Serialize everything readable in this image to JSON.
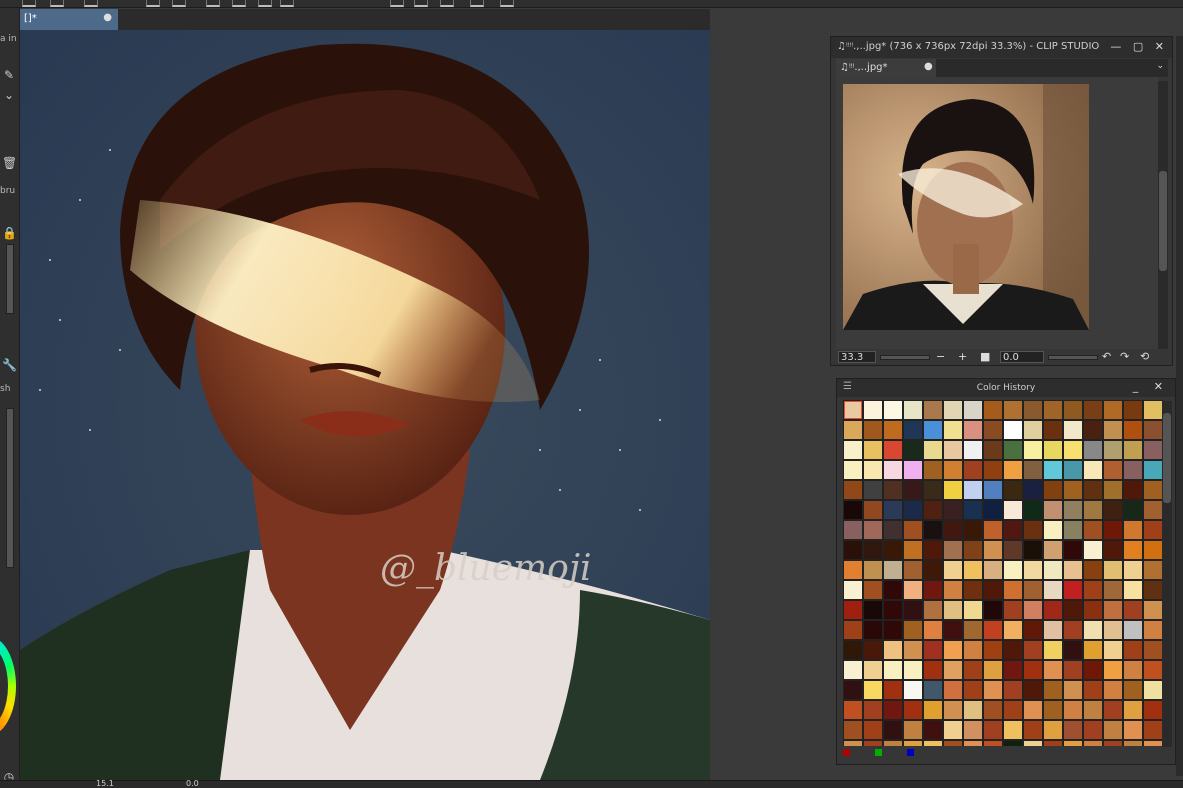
{
  "canvas_tab": {
    "label": "[]*",
    "modified_dot": "●"
  },
  "left_panel": {
    "cut_text_1": "a in",
    "cut_text_2": "bru",
    "cut_text_3": "sh"
  },
  "navigator": {
    "title": "♫ᵎᵎᵎᵎ.,..jpg* (736 x 736px 72dpi 33.3%)  - CLIP STUDIO",
    "window_buttons": "— ▢ ✕",
    "tab_label": "♫ᵎᵎᵎ.,..jpg*",
    "tab_dot": "●",
    "zoom_value": "33.3",
    "rotation_value": "0.0",
    "zoom_out": "−",
    "zoom_in": "+",
    "rotate_left": "↶",
    "rotate_right": "↷",
    "reset": "⟲"
  },
  "color_history": {
    "title": "Color History",
    "window_buttons": "_ ✕",
    "swatches": [
      "#e8c9a0",
      "#fbf3dc",
      "#fdf7e6",
      "#e8e4c8",
      "#a9794c",
      "#e2d5b4",
      "#d9d4c8",
      "#a55b1a",
      "#b07030",
      "#8a5a2e",
      "#a06428",
      "#8f5a20",
      "#7a3e14",
      "#b06a26",
      "#7a3a10",
      "#e0c060",
      "#d9a85a",
      "#a0581c",
      "#c06a20",
      "#1f3656",
      "#4a90d9",
      "#f0e090",
      "#d99080",
      "#8a4a22",
      "#fefefe",
      "#e0d0a0",
      "#6a3010",
      "#f2e7c8",
      "#4a2010",
      "#c09050",
      "#b05010",
      "#8a5030",
      "#f8f0c8",
      "#e8c060",
      "#d84830",
      "#1a2a1a",
      "#e8d890",
      "#e8c8a0",
      "#f0f0f0",
      "#6a3a1a",
      "#4a7040",
      "#f8f0a0",
      "#e8d860",
      "#f8e070",
      "#888888",
      "#b0a070",
      "#c0a050",
      "#886060",
      "#f8f0c0",
      "#f8e8b0",
      "#f8d8e0",
      "#f0b0f0",
      "#a06020",
      "#d08030",
      "#a04020",
      "#904010",
      "#f0a040",
      "#806040",
      "#60c8d8",
      "#4898a8",
      "#f8e8b8",
      "#b06030",
      "#886060",
      "#48a8b8",
      "#904818",
      "#404040",
      "#503020",
      "#381818",
      "#3a2a1a",
      "#f0d040",
      "#c0d0f0",
      "#5080c0",
      "#3a2810",
      "#1a2040",
      "#804010",
      "#a06020",
      "#603010",
      "#a0702a",
      "#501808",
      "#a06020",
      "#1a0808",
      "#904820",
      "#2a3a58",
      "#1a2a48",
      "#502010",
      "#3a2020",
      "#1a3050",
      "#102040",
      "#f8e8d8",
      "#102a18",
      "#c09070",
      "#908060",
      "#a07840",
      "#402010",
      "#182818",
      "#a06030",
      "#886060",
      "#a06858",
      "#403030",
      "#a05020",
      "#1a1010",
      "#401810",
      "#3a1808",
      "#c0602a",
      "#501810",
      "#6a3010",
      "#f8f0c0",
      "#888060",
      "#a05020",
      "#701808",
      "#d07830",
      "#a04018",
      "#2a1008",
      "#301810",
      "#3a1808",
      "#c07020",
      "#501808",
      "#a07050",
      "#804018",
      "#d09050",
      "#603828",
      "#1a1008",
      "#d0a070",
      "#300808",
      "#f8f0d0",
      "#501808",
      "#e08020",
      "#d07010",
      "#e08030",
      "#c09050",
      "#c0b090",
      "#a06030",
      "#401808",
      "#f0d090",
      "#f0c060",
      "#d8b080",
      "#f8f0c0",
      "#f0d8a0",
      "#f0e8c0",
      "#e8c090",
      "#884010",
      "#e0c070",
      "#f0d090",
      "#b07030",
      "#f8f0d0",
      "#a05020",
      "#300808",
      "#f0b080",
      "#701810",
      "#d08040",
      "#703010",
      "#501808",
      "#d07030",
      "#a06030",
      "#e8d8c0",
      "#c02020",
      "#a04018",
      "#a06838",
      "#f8e0a0",
      "#603010",
      "#a02010",
      "#1a0808",
      "#300808",
      "#301010",
      "#b07040",
      "#e0c080",
      "#f0d890",
      "#200808",
      "#a04020",
      "#d08060",
      "#a02818",
      "#501808",
      "#8a3010",
      "#c07040",
      "#a04020",
      "#d09050",
      "#a04018",
      "#2a0808",
      "#300808",
      "#a06020",
      "#e08040",
      "#401010",
      "#a06830",
      "#c04020",
      "#f0b060",
      "#601808",
      "#e0c0a0",
      "#a04020",
      "#f0e0b0",
      "#e0c090",
      "#c0c0c0",
      "#d08040",
      "#301808",
      "#4a1808",
      "#f0c080",
      "#d09050",
      "#a03020",
      "#f0a050",
      "#d08040",
      "#a04010",
      "#501808",
      "#a04020",
      "#f0d060",
      "#301010",
      "#e0a030",
      "#f0d090",
      "#a04018",
      "#a05020",
      "#f8f0d0",
      "#f0d090",
      "#f8f0c0",
      "#f8f0c0",
      "#a03010",
      "#e0a060",
      "#a04018",
      "#e0a040",
      "#701810",
      "#a03010",
      "#e09050",
      "#a04020",
      "#701808",
      "#f0a040",
      "#d08040",
      "#c05020",
      "#301010",
      "#f8d860",
      "#a03010",
      "#f8f8f0",
      "#40586a",
      "#d07040",
      "#a04018",
      "#e09050",
      "#a04020",
      "#501808",
      "#a06020",
      "#d09050",
      "#a04018",
      "#d08040",
      "#a06020",
      "#f0e0a0",
      "#c05020",
      "#a04020",
      "#701810",
      "#a03010",
      "#e0a030",
      "#d09050",
      "#e0c080",
      "#a05020",
      "#a04018",
      "#e09050",
      "#a06020",
      "#d08040",
      "#c08040",
      "#a04020",
      "#e0a040",
      "#a03010",
      "#a05020",
      "#a04018",
      "#301010",
      "#c08040",
      "#401010",
      "#f0d090",
      "#d09060",
      "#a04020",
      "#f0c060",
      "#a04018",
      "#e0a040",
      "#a05030",
      "#a04020",
      "#c08040",
      "#e09050",
      "#a04018",
      "#d09050",
      "#a04020",
      "#c08040",
      "#e0a040",
      "#f0c060",
      "#a05020",
      "#e09050",
      "#c05020",
      "#102010",
      "#f0d090",
      "#a04018",
      "#e0a040",
      "#d08040",
      "#a04020",
      "#c08040",
      "#e09050"
    ],
    "rgb_markers": [
      "#b00000",
      "#00b000",
      "#0000c0"
    ]
  },
  "status": {
    "zoom": "15.1",
    "angle": "0.0"
  }
}
